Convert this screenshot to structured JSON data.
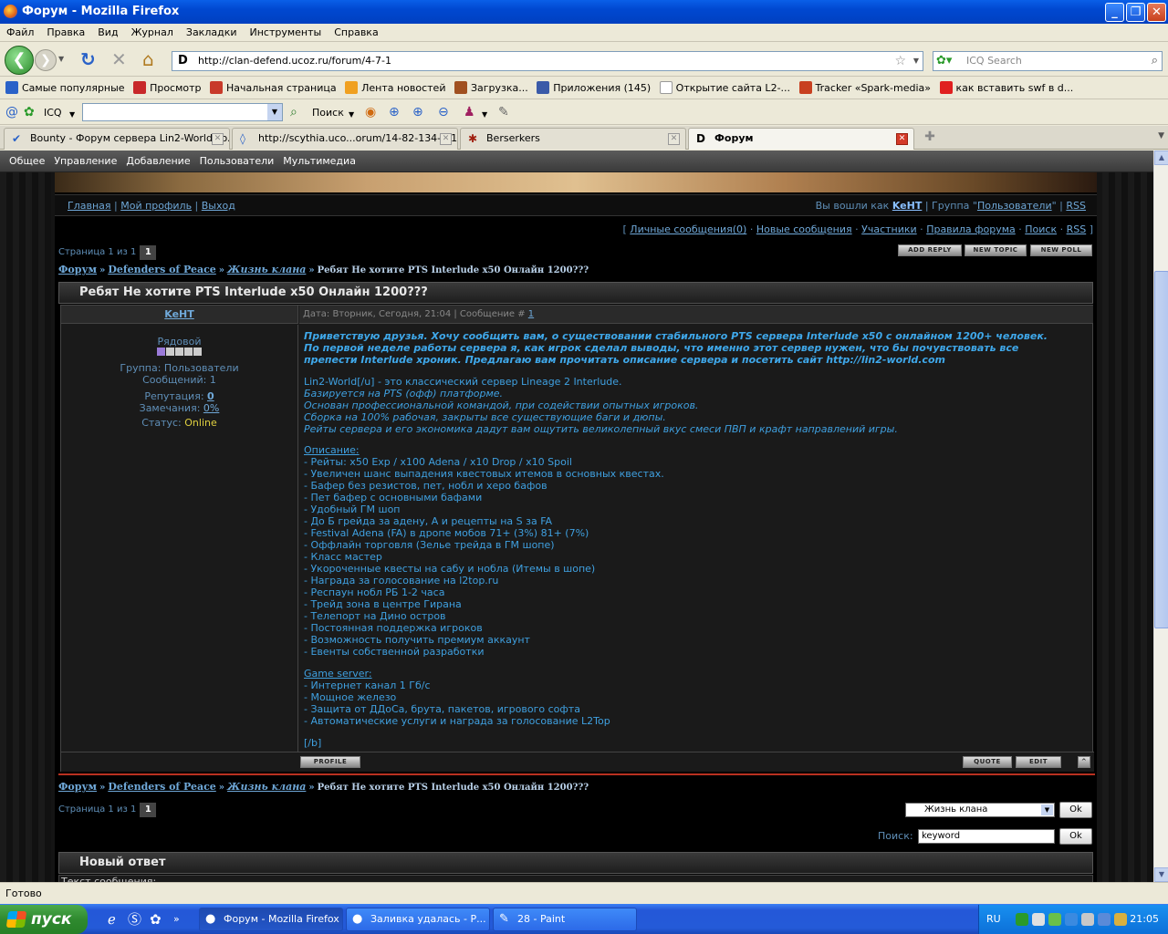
{
  "window": {
    "title": "Форум - Mozilla Firefox",
    "controls": {
      "minimize": "_",
      "maximize": "❐",
      "close": "✕"
    }
  },
  "menu": [
    "Файл",
    "Правка",
    "Вид",
    "Журнал",
    "Закладки",
    "Инструменты",
    "Справка"
  ],
  "navbar": {
    "back_icon": "back-arrow-icon",
    "url": "http://clan-defend.ucoz.ru/forum/4-7-1",
    "search_placeholder": "ICQ Search"
  },
  "bookmarks": [
    {
      "label": "Самые популярные",
      "color": "#2a62c8"
    },
    {
      "label": "Просмотр",
      "color": "#c8282a"
    },
    {
      "label": "Начальная страница",
      "color": "#c83a2a"
    },
    {
      "label": "Лента новостей",
      "color": "#f0a020"
    },
    {
      "label": "Загрузка...",
      "color": "#a05020"
    },
    {
      "label": "Приложения (145)",
      "color": "#3a5aa8"
    },
    {
      "label": "Открытие сайта L2-...",
      "color": "#ffffff"
    },
    {
      "label": "Tracker «Spark-media»",
      "color": "#c84020"
    },
    {
      "label": "как вставить swf в d...",
      "color": "#e02020"
    }
  ],
  "icqbar": {
    "icq_label": "ICQ",
    "search_label": "Поиск"
  },
  "tabs": [
    {
      "label": "Bounty - Форум сервера Lin2-World.co...",
      "icon": "✔",
      "active": false
    },
    {
      "label": "http://scythia.uco...orum/14-82-134-9-1",
      "icon": "◊",
      "active": false
    },
    {
      "label": "Berserkers",
      "icon": "✱",
      "active": false
    },
    {
      "label": "Форум",
      "icon": "D",
      "active": true
    }
  ],
  "ucoz_panel": [
    "Общее",
    "Управление",
    "Добавление",
    "Пользователи",
    "Мультимедиа"
  ],
  "forum": {
    "userbar_links": [
      "Главная",
      "Мой профиль",
      "Выход"
    ],
    "logged_as_prefix": "Вы вошли как",
    "username": "KeHT",
    "group_prefix": "Группа",
    "group_name": "Пользователи",
    "rss": "RSS",
    "topnav": [
      "Личные сообщения(0)",
      "Новые сообщения",
      "Участники",
      "Правила форума",
      "Поиск",
      "RSS"
    ],
    "pager_text": "Страница 1 из 1",
    "pager_num": "1",
    "buttons": {
      "add_reply": "ADD REPLY",
      "new_topic": "NEW TOPIC",
      "new_poll": "NEW POLL",
      "profile": "PROFILE",
      "quote": "QUOTE",
      "edit": "EDIT",
      "up": "^"
    },
    "breadcrumb": [
      "Форум",
      "Defenders of Peace",
      "Жизнь клана"
    ],
    "breadcrumb_current": "Ребят Не хотите PTS Interlude x50 Онлайн 1200???",
    "topic_title": "Ребят Не хотите PTS Interlude x50 Онлайн 1200???",
    "post": {
      "author": "KeHT",
      "date_text": "Дата: Вторник, Сегодня, 21:04 | Сообщение #",
      "post_number": "1",
      "rank": "Рядовой",
      "stars_filled": 1,
      "stars_total": 5,
      "group": "Группа: Пользователи",
      "messages": "Сообщений: 1",
      "reputation_label": "Репутация:",
      "reputation": "0",
      "warnings_label": "Замечания:",
      "warnings": "0%",
      "status_label": "Статус:",
      "status": "Online",
      "intro": [
        "Приветствую друзья. Хочу сообщить вам, о существовании стабильного PTS сервера Interlude x50 с онлайном 1200+ человек.",
        "По первой неделе работы сервера я, как игрок сделал выводы, что именно этот сервер нужен, что бы почувствовать все",
        "препести Interlude хроник. Предлагаю вам прочитать описание сервера и посетить сайт http://lin2-world.com"
      ],
      "about": [
        "Lin2-World[/u] - это классический сервер Lineage 2 Interlude.",
        "Базируется на PTS (офф) платформе.",
        "Основан профессиональной командой, при содействии опытных игроков.",
        "Сборка на 100% рабочая, закрыты все существующие баги и дюпы.",
        "Рейты сервера и его экономика дадут вам ощутить великолепный вкус смеси ПВП и крафт направлений игры."
      ],
      "desc_title": "Описание:",
      "desc": [
        "- Рейты: x50 Exp / x100 Adena / x10 Drop / x10 Spoil",
        "- Увеличен шанс выпадения квестовых итемов в основных квестах.",
        "- Бафер без резистов, пет, нобл и херо бафов",
        "- Пет бафер с основными бафами",
        "- Удобный ГМ шоп",
        "- До Б грейда за адену, А и рецепты на S за FA",
        "- Festival Adena (FA) в дропе мобов 71+ (3%) 81+ (7%)",
        "- Оффлайн торговля (Зелье трейда в ГМ шопе)",
        "- Класс мастер",
        "- Укороченные квесты на сабу и нобла (Итемы в шопе)",
        "- Награда за голосование на l2top.ru",
        "- Респаун нобл РБ 1-2 часа",
        "- Трейд зона в центре Гирана",
        "- Телепорт на Дино остров",
        "- Постоянная поддержка игроков",
        "- Возможность получить премиум аккаунт",
        "- Евенты собственной разработки"
      ],
      "server_title": "Game server:",
      "server": [
        "- Интернет канал 1 Гб/с",
        "- Мощное железо",
        "- Защита от ДДоСа, брута, пакетов, игрового софта",
        "- Автоматические услуги и награда за голосование L2Top"
      ],
      "closing": "[/b]"
    },
    "jump_select": "Жизнь клана",
    "ok": "Ok",
    "search_label": "Поиск:",
    "search_value": "keyword",
    "reply_title": "Новый ответ",
    "reply_sub": "Текст сообщения:"
  },
  "status": "Готово",
  "taskbar": {
    "start": "пуск",
    "tasks": [
      {
        "label": "Форум - Mozilla Firefox",
        "active": true
      },
      {
        "label": "Заливка удалась - Р...",
        "active": false
      },
      {
        "label": "28 - Paint",
        "active": false
      }
    ],
    "lang": "RU",
    "clock": "21:05"
  },
  "colors": {
    "link": "#6fa8d8",
    "post_text": "#3fa0e0",
    "status_online": "#e0d040",
    "accent_red": "#b83020"
  }
}
